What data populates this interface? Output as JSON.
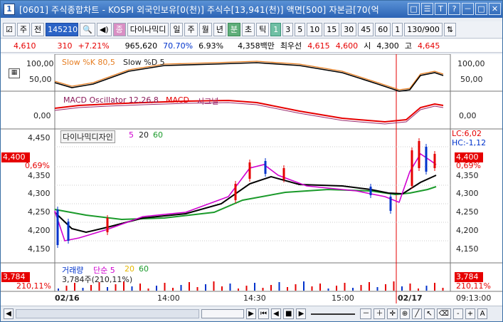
{
  "window": {
    "number": "1",
    "title": "[0601] 주식종합차트 - KOSPI 외국인보유[0(천)] 주식수[13,941(천)] 액면[500] 자본금[70(억",
    "title_buttons": [
      "□",
      "☰",
      "T",
      "?",
      "－",
      "□",
      "✕"
    ]
  },
  "toolbar": {
    "market": "주",
    "prefix": "전",
    "code": "145210",
    "stock_name": "다이나믹디",
    "periods": [
      "일",
      "주",
      "월",
      "년",
      "분",
      "초",
      "틱"
    ],
    "active_period": "분",
    "intervals": [
      "1",
      "3",
      "5",
      "10",
      "15",
      "30",
      "45",
      "60"
    ],
    "active_interval": "1",
    "interval_value": "1",
    "count": "130/900"
  },
  "quote": {
    "price": "4,610",
    "change": "310",
    "pct": "+7.21%",
    "volume": "965,620",
    "ratio": "70.70%",
    "turnover": "6.93%",
    "amount": "4,358백만",
    "best_label": "최우선",
    "best_ask": "4,615",
    "best_bid": "4,600",
    "open_label": "시",
    "open": "4,300",
    "high_label": "고",
    "high": "4,645"
  },
  "panels": {
    "stoch": {
      "legend": "Slow %K 80,5",
      "legend2": "Slow %D 5",
      "ticks": [
        "100,00",
        "50,00"
      ]
    },
    "macd": {
      "legend": "MACD Oscillator 12,26,8",
      "legend2": "MACD",
      "legend3": "시그널",
      "ticks": [
        "0,00"
      ]
    },
    "price": {
      "legend_name": "다이나믹디자인",
      "ma": [
        "5",
        "20",
        "60"
      ],
      "ticks": [
        "4,450",
        "4,400",
        "4,350",
        "4,300",
        "4,250",
        "4,200",
        "4,150"
      ],
      "current": "4,400",
      "current_pct": "0,69%",
      "lc": "LC:6,02",
      "hc": "HC:-1,12"
    },
    "volume": {
      "legend": "거래량",
      "legend_ma": "단순 5",
      "legend_ma2": "20",
      "legend_ma3": "60",
      "value": "3,784",
      "pct": "210,11%",
      "summary": "3,784주(210,11%)"
    }
  },
  "xaxis": {
    "labels": [
      "02/16",
      "14:00",
      "14:30",
      "15:00",
      "02/17"
    ],
    "right_time": "09:13:00"
  },
  "colors": {
    "up": "#e60000",
    "down": "#0033cc",
    "ma5": "#d000d0",
    "ma20": "#000000",
    "ma60": "#1a9a2a",
    "macd": "#e60000",
    "signal": "#9b2b6f"
  }
}
